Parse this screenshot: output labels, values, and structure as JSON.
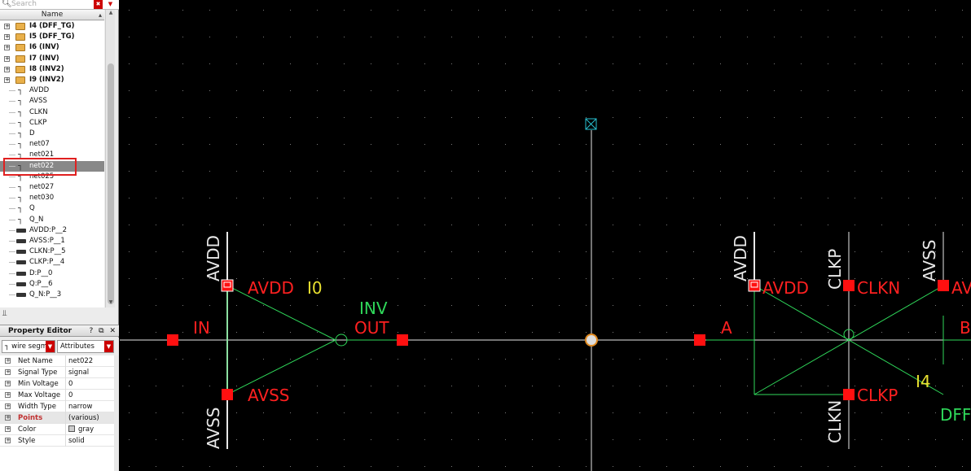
{
  "search": {
    "placeholder": "Search"
  },
  "tree": {
    "header": "Name",
    "items": [
      {
        "label": "I4 (DFF_TG)",
        "type": "instance"
      },
      {
        "label": "I5 (DFF_TG)",
        "type": "instance"
      },
      {
        "label": "I6 (INV)",
        "type": "instance"
      },
      {
        "label": "I7 (INV)",
        "type": "instance"
      },
      {
        "label": "I8 (INV2)",
        "type": "instance"
      },
      {
        "label": "I9 (INV2)",
        "type": "instance"
      },
      {
        "label": "AVDD",
        "type": "net"
      },
      {
        "label": "AVSS",
        "type": "net"
      },
      {
        "label": "CLKN",
        "type": "net"
      },
      {
        "label": "CLKP",
        "type": "net"
      },
      {
        "label": "D",
        "type": "net"
      },
      {
        "label": "net07",
        "type": "net"
      },
      {
        "label": "net021",
        "type": "net"
      },
      {
        "label": "net022",
        "type": "net",
        "selected": true
      },
      {
        "label": "net025",
        "type": "net"
      },
      {
        "label": "net027",
        "type": "net"
      },
      {
        "label": "net030",
        "type": "net"
      },
      {
        "label": "Q",
        "type": "net"
      },
      {
        "label": "Q_N",
        "type": "net"
      },
      {
        "label": "AVDD:P__2",
        "type": "pin"
      },
      {
        "label": "AVSS:P__1",
        "type": "pin"
      },
      {
        "label": "CLKN:P__5",
        "type": "pin"
      },
      {
        "label": "CLKP:P__4",
        "type": "pin"
      },
      {
        "label": "D:P__0",
        "type": "pin"
      },
      {
        "label": "Q:P__6",
        "type": "pin"
      },
      {
        "label": "Q_N:P__3",
        "type": "pin"
      }
    ]
  },
  "property_editor": {
    "title": "Property Editor",
    "object_combo": "wire segm",
    "mode_combo": "Attributes",
    "rows": [
      {
        "name": "Net Name",
        "value": "net022"
      },
      {
        "name": "Signal Type",
        "value": "signal"
      },
      {
        "name": "Min Voltage",
        "value": "0"
      },
      {
        "name": "Max Voltage",
        "value": "0"
      },
      {
        "name": "Width Type",
        "value": "narrow"
      },
      {
        "name": "Points",
        "value": "(various)"
      },
      {
        "name": "Color",
        "value": "gray"
      },
      {
        "name": "Style",
        "value": "solid"
      }
    ]
  },
  "schematic": {
    "inv": {
      "pin_avdd": "AVDD",
      "pin_avss": "AVSS",
      "pin_in": "IN",
      "pin_out": "OUT",
      "cell_name": "INV",
      "instance": "I0",
      "net_avdd": "AVDD",
      "net_avss": "AVSS"
    },
    "dff": {
      "pin_avdd": "AVDD",
      "pin_clkn": "CLKN",
      "pin_clkp": "CLKP",
      "pin_a": "A",
      "pin_av_partial": "AV",
      "pin_b_partial": "B",
      "instance": "I4",
      "cell_partial": "DFF",
      "net_avdd": "AVDD",
      "net_clkp_top": "CLKP",
      "net_avss": "AVSS",
      "net_clkn_bottom": "CLKN"
    },
    "colors": {
      "background": "#000000",
      "wire": "#e8e8e8",
      "symbol": "#2fd85a",
      "pin": "#ff1010",
      "instance_label": "#e8e030"
    }
  }
}
